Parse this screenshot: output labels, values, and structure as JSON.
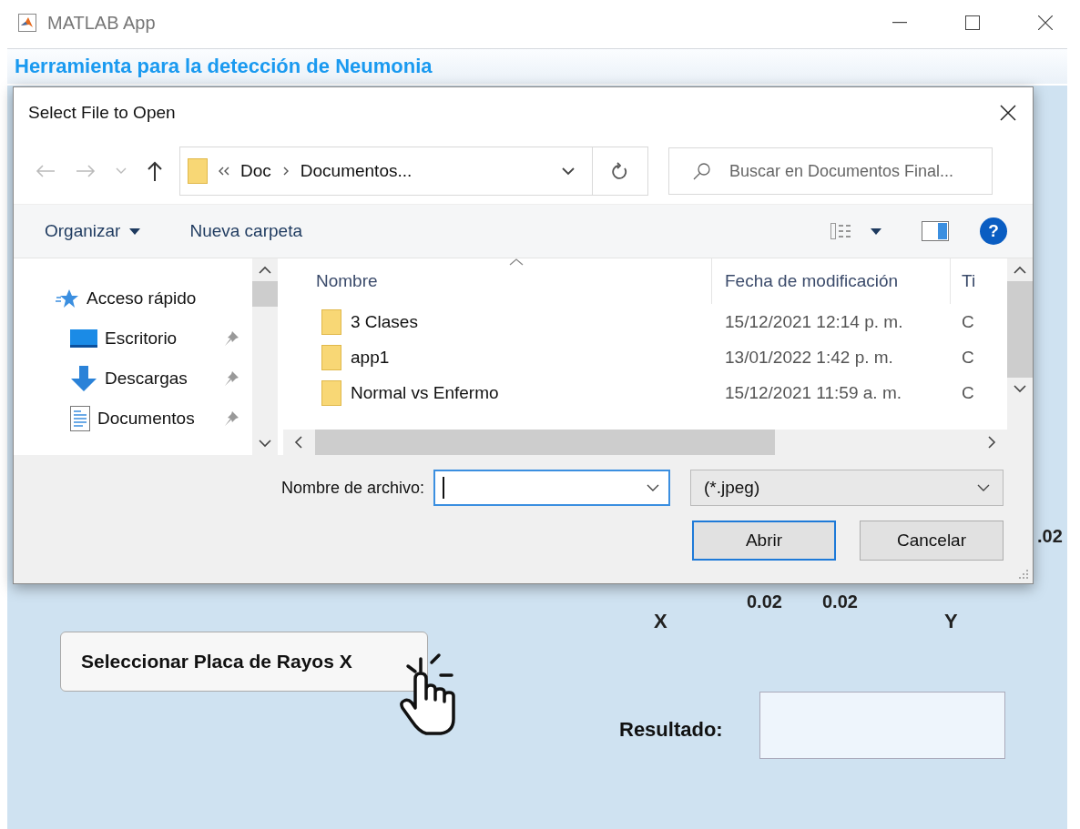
{
  "window": {
    "title": "MATLAB App"
  },
  "app": {
    "title": "Herramienta para la detección de Neumonia",
    "axis_labels": [
      {
        "text": "X",
        "kind": "axis"
      },
      {
        "text": "0.02",
        "kind": "tick"
      },
      {
        "text": "0.02",
        "kind": "tick"
      },
      {
        "text": "Y",
        "kind": "axis"
      },
      {
        "text": ".02",
        "kind": "tick"
      }
    ],
    "select_button": "Seleccionar Placa de Rayos X",
    "result_label": "Resultado:"
  },
  "dialog": {
    "title": "Select File to Open",
    "path": [
      "Doc",
      "Documentos..."
    ],
    "search_placeholder": "Buscar en Documentos Final...",
    "toolbar": {
      "organize": "Organizar",
      "new_folder": "Nueva carpeta",
      "help": "?"
    },
    "sidebar": [
      {
        "label": "Acceso rápido",
        "kind": "quick-access",
        "pinned": false
      },
      {
        "label": "Escritorio",
        "kind": "desktop",
        "pinned": true
      },
      {
        "label": "Descargas",
        "kind": "downloads",
        "pinned": true
      },
      {
        "label": "Documentos",
        "kind": "documents",
        "pinned": true
      }
    ],
    "columns": [
      "Nombre",
      "Fecha de modificación",
      "Ti"
    ],
    "rows": [
      {
        "name": "3 Clases",
        "date": "15/12/2021 12:14 p. m.",
        "type": "C"
      },
      {
        "name": "app1",
        "date": "13/01/2022 1:42 p. m.",
        "type": "C"
      },
      {
        "name": "Normal vs Enfermo",
        "date": "15/12/2021 11:59 a. m.",
        "type": "C"
      }
    ],
    "filename": {
      "label": "Nombre de archivo:",
      "focused": true
    },
    "filetype": "(*.jpeg)",
    "buttons": [
      {
        "label": "Abrir",
        "default": true
      },
      {
        "label": "Cancelar",
        "default": false
      }
    ]
  }
}
